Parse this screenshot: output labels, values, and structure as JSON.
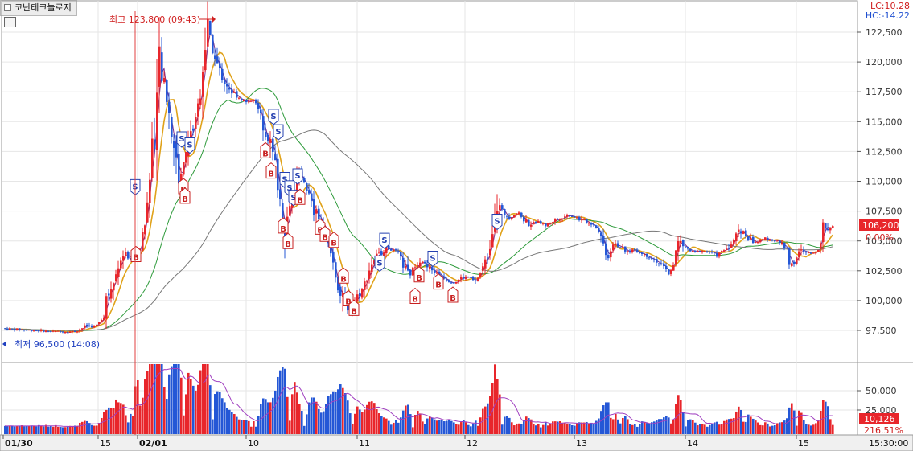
{
  "header": {
    "stock_name": "코난테크놀로지",
    "lc_label": "LC:10.28",
    "hc_label": "HC:-14.22"
  },
  "colors": {
    "up": "#e8262b",
    "down": "#2457d6",
    "ma_fast": "#7a2e8c",
    "ma_mid": "#e0a21a",
    "ma_slow": "#2d9a3a",
    "ma_long": "#777777",
    "grid": "#e6e6e6"
  },
  "chart_data": {
    "type": "candlestick",
    "price_axis": {
      "min": 96500,
      "max": 123800,
      "ticks": [
        "122,500",
        "120,000",
        "117,500",
        "115,000",
        "112,500",
        "110,000",
        "107,500",
        "105,000",
        "102,500",
        "100,000",
        "97,500"
      ]
    },
    "volume_axis": {
      "ticks": [
        "50,000",
        "25,000"
      ]
    },
    "x_ticks": [
      "01/30",
      "15",
      "02/01",
      "10",
      "11",
      "12",
      "13",
      "14",
      "15"
    ],
    "time_label": "15:30:00",
    "high_annotation": "최고 123,800 (09:43)",
    "low_annotation": "최저 96,500 (14:08)",
    "current_price": "106,200",
    "change_pct": "0.00%",
    "current_volume": "10,126",
    "volume_ratio": "216.51%",
    "signal_letters": {
      "buy": "B",
      "sell": "S"
    },
    "price_path": [
      [
        0,
        97700
      ],
      [
        25,
        97600
      ],
      [
        50,
        97500
      ],
      [
        75,
        97400
      ],
      [
        100,
        97400
      ],
      [
        115,
        97900
      ],
      [
        125,
        97800
      ],
      [
        135,
        98500
      ],
      [
        140,
        100500
      ],
      [
        150,
        102500
      ],
      [
        160,
        104000
      ],
      [
        168,
        103500
      ],
      [
        175,
        103800
      ],
      [
        182,
        104500
      ],
      [
        190,
        108000
      ],
      [
        195,
        112500
      ],
      [
        200,
        115000
      ],
      [
        205,
        119500
      ],
      [
        210,
        118500
      ],
      [
        215,
        116500
      ],
      [
        220,
        114500
      ],
      [
        225,
        112000
      ],
      [
        230,
        110000
      ],
      [
        235,
        111500
      ],
      [
        240,
        113500
      ],
      [
        245,
        114000
      ],
      [
        250,
        115500
      ],
      [
        255,
        117000
      ],
      [
        260,
        120500
      ],
      [
        265,
        122500
      ],
      [
        270,
        121000
      ],
      [
        275,
        120000
      ],
      [
        285,
        118500
      ],
      [
        295,
        117500
      ],
      [
        305,
        117000
      ],
      [
        315,
        116500
      ],
      [
        322,
        117000
      ],
      [
        328,
        116000
      ],
      [
        335,
        114500
      ],
      [
        342,
        113500
      ],
      [
        350,
        111000
      ],
      [
        356,
        108000
      ],
      [
        362,
        106000
      ],
      [
        368,
        108500
      ],
      [
        375,
        110000
      ],
      [
        382,
        110500
      ],
      [
        390,
        109000
      ],
      [
        396,
        107500
      ],
      [
        403,
        107000
      ],
      [
        410,
        106000
      ],
      [
        415,
        104500
      ],
      [
        420,
        103500
      ],
      [
        425,
        102000
      ],
      [
        430,
        100500
      ],
      [
        435,
        99500
      ],
      [
        440,
        98800
      ],
      [
        446,
        99800
      ],
      [
        452,
        100500
      ],
      [
        458,
        101000
      ],
      [
        465,
        102500
      ],
      [
        472,
        103500
      ],
      [
        480,
        104000
      ],
      [
        488,
        104500
      ],
      [
        495,
        104200
      ],
      [
        502,
        104000
      ],
      [
        508,
        103000
      ],
      [
        515,
        102000
      ],
      [
        522,
        103000
      ],
      [
        530,
        103500
      ],
      [
        538,
        102800
      ],
      [
        545,
        102500
      ],
      [
        552,
        102200
      ],
      [
        558,
        102000
      ],
      [
        565,
        101700
      ],
      [
        572,
        101500
      ],
      [
        580,
        101900
      ],
      [
        590,
        102000
      ],
      [
        598,
        101500
      ],
      [
        605,
        102500
      ],
      [
        612,
        103500
      ],
      [
        618,
        105500
      ],
      [
        622,
        108000
      ],
      [
        628,
        107800
      ],
      [
        635,
        107200
      ],
      [
        642,
        107000
      ],
      [
        650,
        107400
      ],
      [
        658,
        106800
      ],
      [
        665,
        106400
      ],
      [
        675,
        106600
      ],
      [
        685,
        106300
      ],
      [
        695,
        106700
      ],
      [
        705,
        107000
      ],
      [
        715,
        107200
      ],
      [
        725,
        106900
      ],
      [
        735,
        106600
      ],
      [
        745,
        106400
      ],
      [
        752,
        105800
      ],
      [
        758,
        104500
      ],
      [
        763,
        103800
      ],
      [
        770,
        105000
      ],
      [
        778,
        104500
      ],
      [
        785,
        104000
      ],
      [
        795,
        104300
      ],
      [
        805,
        103900
      ],
      [
        815,
        103700
      ],
      [
        825,
        103200
      ],
      [
        832,
        102700
      ],
      [
        838,
        102300
      ],
      [
        843,
        102800
      ],
      [
        850,
        104800
      ],
      [
        858,
        104500
      ],
      [
        868,
        104000
      ],
      [
        878,
        104200
      ],
      [
        888,
        104100
      ],
      [
        898,
        103800
      ],
      [
        908,
        104300
      ],
      [
        918,
        104800
      ],
      [
        926,
        106200
      ],
      [
        932,
        105600
      ],
      [
        940,
        105100
      ],
      [
        948,
        104900
      ],
      [
        958,
        105200
      ],
      [
        968,
        105100
      ],
      [
        978,
        104800
      ],
      [
        985,
        104300
      ],
      [
        990,
        102800
      ],
      [
        996,
        103500
      ],
      [
        1002,
        104100
      ],
      [
        1010,
        104000
      ],
      [
        1018,
        103900
      ],
      [
        1025,
        104500
      ],
      [
        1030,
        106000
      ],
      [
        1036,
        106200
      ]
    ],
    "signals": [
      {
        "type": "S",
        "x": 168,
        "price": 109400
      },
      {
        "type": "B",
        "x": 169,
        "price": 104000
      },
      {
        "type": "S",
        "x": 226,
        "price": 113400
      },
      {
        "type": "S",
        "x": 236,
        "price": 112900
      },
      {
        "type": "B",
        "x": 228,
        "price": 109700
      },
      {
        "type": "B",
        "x": 230,
        "price": 108900
      },
      {
        "type": "S",
        "x": 340,
        "price": 115300
      },
      {
        "type": "S",
        "x": 346,
        "price": 114000
      },
      {
        "type": "B",
        "x": 330,
        "price": 112700
      },
      {
        "type": "B",
        "x": 337,
        "price": 111000
      },
      {
        "type": "S",
        "x": 354,
        "price": 110000
      },
      {
        "type": "S",
        "x": 360,
        "price": 109300
      },
      {
        "type": "S",
        "x": 365,
        "price": 108500
      },
      {
        "type": "S",
        "x": 370,
        "price": 110300
      },
      {
        "type": "B",
        "x": 352,
        "price": 106400
      },
      {
        "type": "B",
        "x": 358,
        "price": 105100
      },
      {
        "type": "B",
        "x": 373,
        "price": 108800
      },
      {
        "type": "B",
        "x": 398,
        "price": 106300
      },
      {
        "type": "B",
        "x": 404,
        "price": 105700
      },
      {
        "type": "B",
        "x": 415,
        "price": 105200
      },
      {
        "type": "B",
        "x": 427,
        "price": 102200
      },
      {
        "type": "B",
        "x": 433,
        "price": 100300
      },
      {
        "type": "B",
        "x": 440,
        "price": 99500
      },
      {
        "type": "S",
        "x": 478,
        "price": 104900
      },
      {
        "type": "S",
        "x": 472,
        "price": 103000
      },
      {
        "type": "B",
        "x": 516,
        "price": 100500
      },
      {
        "type": "B",
        "x": 521,
        "price": 102300
      },
      {
        "type": "S",
        "x": 538,
        "price": 103400
      },
      {
        "type": "B",
        "x": 545,
        "price": 101700
      },
      {
        "type": "B",
        "x": 563,
        "price": 100600
      },
      {
        "type": "S",
        "x": 618,
        "price": 106500
      }
    ]
  }
}
